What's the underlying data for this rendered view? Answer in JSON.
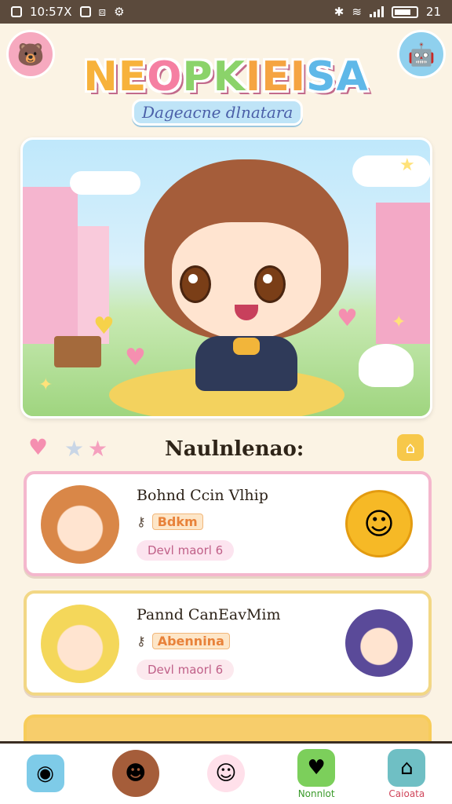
{
  "status_bar": {
    "time_left": "10:57X",
    "time_right": "21"
  },
  "header": {
    "title_parts": [
      "NE",
      "O",
      "PK",
      "IEI",
      "SA"
    ],
    "subtitle": "Dageacne dlnatara"
  },
  "section": {
    "title": "Naulnlenao:"
  },
  "cards": [
    {
      "title": "Bohnd Ccin Vlhip",
      "meta_tag": "Bdkm",
      "pill": "Devl maorl 6"
    },
    {
      "title": "Pannd CanEavMim",
      "meta_tag": "Abennina",
      "pill": "Devl maorl 6"
    }
  ],
  "bottom_nav": {
    "items": [
      {
        "icon": "robot-icon",
        "label": ""
      },
      {
        "icon": "avatar-icon",
        "label": ""
      },
      {
        "icon": "ghost-icon",
        "label": ""
      },
      {
        "icon": "heart-icon",
        "label": "Nonnlot"
      },
      {
        "icon": "basket-icon",
        "label": "Caioata"
      }
    ]
  },
  "colors": {
    "background": "#fbf3e4",
    "status_bar": "#5b4a3c",
    "accent_pink": "#f57fa2",
    "accent_yellow": "#f7b23b"
  }
}
